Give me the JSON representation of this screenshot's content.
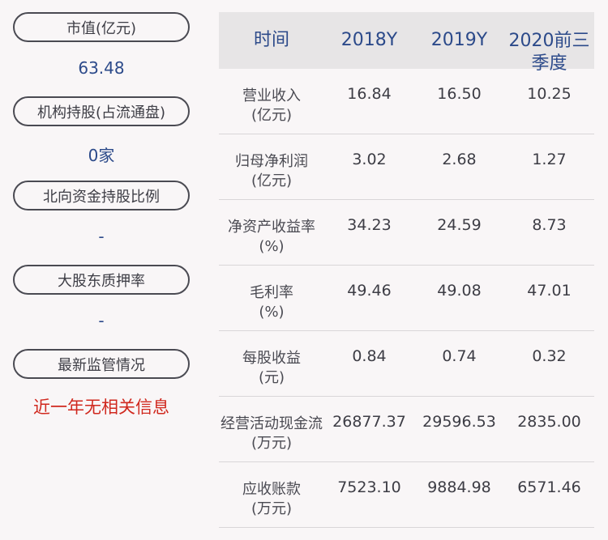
{
  "left": {
    "items": [
      {
        "label": "市值(亿元)",
        "value": "63.48"
      },
      {
        "label": "机构持股(占流通盘)",
        "value": "0家"
      },
      {
        "label": "北向资金持股比例",
        "value": "-"
      },
      {
        "label": "大股东质押率",
        "value": "-"
      },
      {
        "label": "最新监管情况",
        "value": "近一年无相关信息"
      }
    ]
  },
  "table": {
    "headers": [
      "时间",
      "2018Y",
      "2019Y",
      "2020前三季度"
    ],
    "rows": [
      {
        "metric": "营业收入",
        "unit": "(亿元)",
        "values": [
          "16.84",
          "16.50",
          "10.25"
        ]
      },
      {
        "metric": "归母净利润",
        "unit": "(亿元)",
        "values": [
          "3.02",
          "2.68",
          "1.27"
        ]
      },
      {
        "metric": "净资产收益率",
        "unit": "(%)",
        "values": [
          "34.23",
          "24.59",
          "8.73"
        ]
      },
      {
        "metric": "毛利率",
        "unit": "(%)",
        "values": [
          "49.46",
          "49.08",
          "47.01"
        ]
      },
      {
        "metric": "每股收益",
        "unit": "(元)",
        "values": [
          "0.84",
          "0.74",
          "0.32"
        ]
      },
      {
        "metric": "经营活动现金流",
        "unit": "(万元)",
        "values": [
          "26877.37",
          "29596.53",
          "2835.00"
        ]
      },
      {
        "metric": "应收账款",
        "unit": "(万元)",
        "values": [
          "7523.10",
          "9884.98",
          "6571.46"
        ]
      }
    ]
  },
  "colors": {
    "background": "#f9f6f7",
    "header_bg": "#e7e5e6",
    "header_text": "#2c4a8a",
    "value_blue": "#2c4a8a",
    "value_red": "#d0281e",
    "pill_border": "#4a4a52"
  }
}
